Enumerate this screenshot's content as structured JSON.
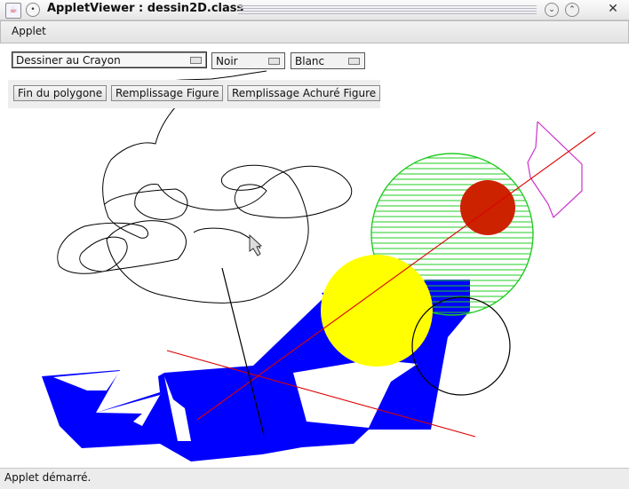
{
  "window": {
    "title": "AppletViewer : dessin2D.class",
    "app_icon": "java-icon",
    "buttons": [
      "window-menu-icon",
      "minimize-icon",
      "maximize-icon",
      "close-icon"
    ]
  },
  "menubar": {
    "items": [
      {
        "label": "Applet"
      }
    ]
  },
  "toolbar": {
    "mode_select": {
      "value": "Dessiner au Crayon"
    },
    "color_select": {
      "value": "Noir"
    },
    "fill_select": {
      "value": "Blanc"
    },
    "buttons": [
      {
        "label": "Fin du polygone"
      },
      {
        "label": "Remplissage Figure"
      },
      {
        "label": "Remplissage Achuré Figure"
      }
    ]
  },
  "status": {
    "text": "Applet démarré."
  },
  "colors": {
    "blue_fill": "#0000ff",
    "yellow_fill": "#ffff00",
    "green_circle": "#22cc22",
    "red_disc": "#cc2200",
    "red_line": "#dd0000",
    "magenta_polygon": "#cc33cc",
    "black_stroke": "#000000"
  }
}
